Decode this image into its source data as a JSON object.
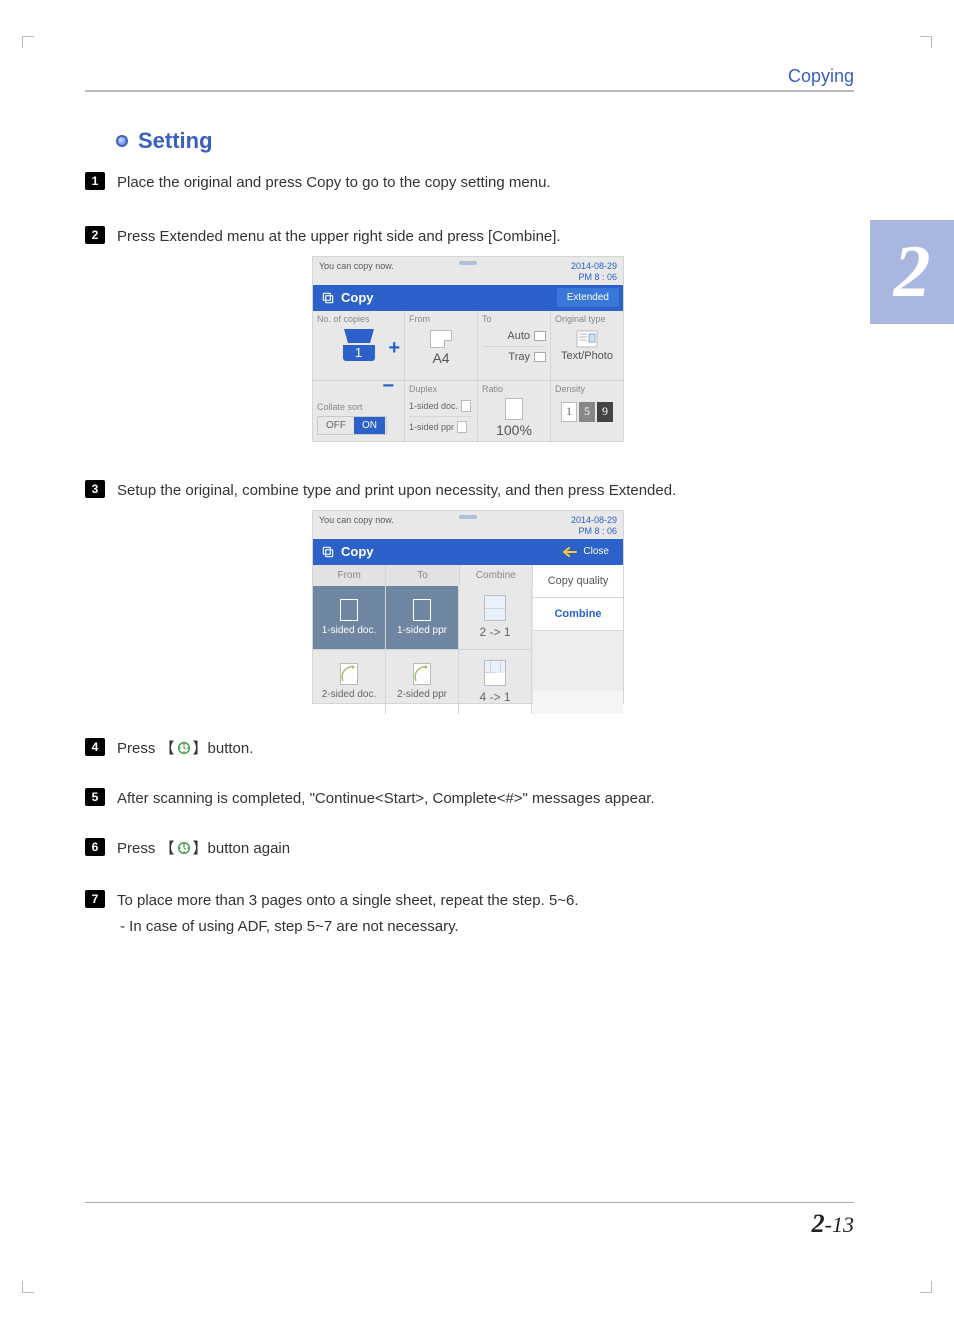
{
  "header": {
    "title": "Copying"
  },
  "section": {
    "title": "Setting"
  },
  "chapter_tab": "2",
  "steps": {
    "s1": {
      "num": "1",
      "text": "Place the original and press Copy to go to the copy setting menu."
    },
    "s2": {
      "num": "2",
      "text": "Press Extended menu at the upper right side and press [Combine]."
    },
    "s3": {
      "num": "3",
      "text": "Setup the original, combine type and print upon necessity, and then press Extended."
    },
    "s4": {
      "num": "4",
      "prefix": "Press 【",
      "suffix": "】button."
    },
    "s5": {
      "num": "5",
      "text": "After scanning is completed, \"Continue<Start>, Complete<#>\" messages appear."
    },
    "s6": {
      "num": "6",
      "prefix": "Press 【",
      "suffix": "】button again"
    },
    "s7": {
      "num": "7",
      "text": "To place more than 3 pages onto a single sheet, repeat the step. 5~6."
    },
    "s7_sub": "-   In case of using ADF, step 5~7 are not necessary."
  },
  "screenshot1": {
    "status": "You can copy now.",
    "date": "2014-08-29",
    "time": "PM 8 : 06",
    "title": "Copy",
    "extended": "Extended",
    "labels": {
      "copies": "No. of copies",
      "from": "From",
      "to": "To",
      "original_type": "Original type",
      "duplex": "Duplex",
      "ratio": "Ratio",
      "density": "Density",
      "collate": "Collate sort"
    },
    "values": {
      "copies": "1",
      "from": "A4",
      "to_auto": "Auto",
      "to_tray": "Tray",
      "original_type": "Text/Photo",
      "duplex1": "1-sided doc.",
      "duplex2": "1-sided ppr",
      "ratio": "100%",
      "off": "OFF",
      "on": "ON",
      "d1": "1",
      "d2": "5",
      "d3": "9"
    }
  },
  "screenshot2": {
    "status": "You can copy now.",
    "date": "2014-08-29",
    "time": "PM 8 : 06",
    "title": "Copy",
    "close": "Close",
    "tabs": {
      "from": "From",
      "to": "To",
      "combine": "Combine"
    },
    "right": {
      "quality": "Copy quality",
      "combine": "Combine"
    },
    "cells": {
      "c1": "1-sided doc.",
      "c2": "1-sided ppr",
      "c3": "2 -> 1",
      "c4": "2-sided doc.",
      "c5": "2-sided ppr",
      "c6": "4 -> 1"
    }
  },
  "footer": {
    "chapter": "2",
    "sep": "-",
    "page": "13"
  }
}
